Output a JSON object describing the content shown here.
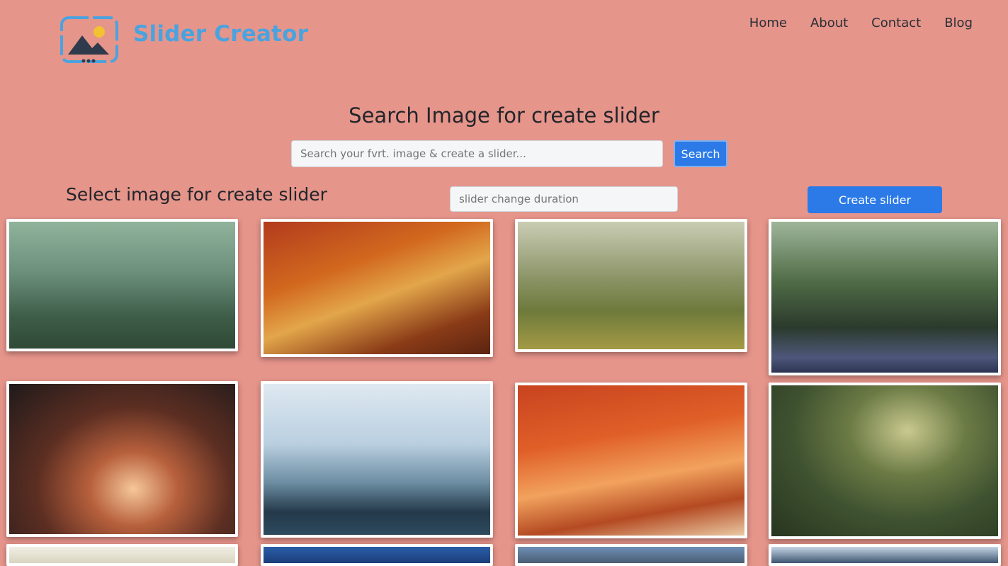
{
  "brand": {
    "name": "Slider Creator",
    "accent": "#4aa3df"
  },
  "nav": {
    "items": [
      "Home",
      "About",
      "Contact",
      "Blog"
    ]
  },
  "search": {
    "heading": "Search Image for create slider",
    "placeholder": "Search your fvrt. image & create a slider...",
    "button_label": "Search"
  },
  "slider": {
    "heading": "Select image for create slider",
    "duration_placeholder": "slider change duration",
    "create_label": "Create slider"
  },
  "colors": {
    "background": "#e6958b",
    "primary_button": "#2b7ae8"
  },
  "images": [
    "misty-forest",
    "autumn-forest-road",
    "sunlit-forest",
    "forest-path-sunrays",
    "foggy-autumn-trees",
    "misty-mountain-forest",
    "red-autumn-path",
    "mossy-forest-trail",
    "pale-sky",
    "blue-night",
    "clouds-hills",
    "lake-clouds"
  ]
}
